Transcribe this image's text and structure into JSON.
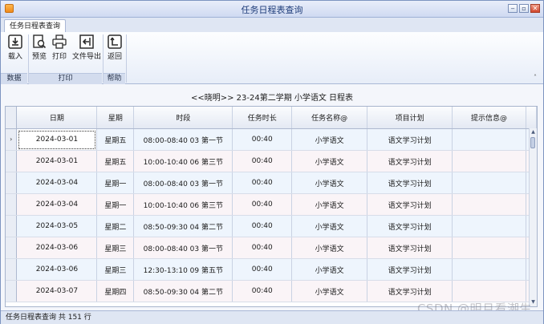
{
  "window": {
    "title": "任务日程表查询"
  },
  "ribbon": {
    "tab": "任务日程表查询",
    "buttons": {
      "import": "载入",
      "preview": "预览",
      "print": "打印",
      "export": "文件导出",
      "back": "返回"
    },
    "groups": {
      "data": "数据",
      "print": "打印",
      "help": "帮助"
    }
  },
  "heading": "<<晓明>>  23-24第二学期  小学语文  日程表",
  "columns": [
    "日期",
    "星期",
    "时段",
    "任务时长",
    "任务名称@",
    "项目计划",
    "提示信息@"
  ],
  "rows": [
    {
      "date": "2024-03-01",
      "weekday": "星期五",
      "period": "08:00-08:40 03 第一节",
      "duration": "00:40",
      "task": "小学语文",
      "plan": "语文学习计划",
      "tip": ""
    },
    {
      "date": "2024-03-01",
      "weekday": "星期五",
      "period": "10:00-10:40 06 第三节",
      "duration": "00:40",
      "task": "小学语文",
      "plan": "语文学习计划",
      "tip": ""
    },
    {
      "date": "2024-03-04",
      "weekday": "星期一",
      "period": "08:00-08:40 03 第一节",
      "duration": "00:40",
      "task": "小学语文",
      "plan": "语文学习计划",
      "tip": ""
    },
    {
      "date": "2024-03-04",
      "weekday": "星期一",
      "period": "10:00-10:40 06 第三节",
      "duration": "00:40",
      "task": "小学语文",
      "plan": "语文学习计划",
      "tip": ""
    },
    {
      "date": "2024-03-05",
      "weekday": "星期二",
      "period": "08:50-09:30 04 第二节",
      "duration": "00:40",
      "task": "小学语文",
      "plan": "语文学习计划",
      "tip": ""
    },
    {
      "date": "2024-03-06",
      "weekday": "星期三",
      "period": "08:00-08:40 03 第一节",
      "duration": "00:40",
      "task": "小学语文",
      "plan": "语文学习计划",
      "tip": ""
    },
    {
      "date": "2024-03-06",
      "weekday": "星期三",
      "period": "12:30-13:10 09 第五节",
      "duration": "00:40",
      "task": "小学语文",
      "plan": "语文学习计划",
      "tip": ""
    },
    {
      "date": "2024-03-07",
      "weekday": "星期四",
      "period": "08:50-09:30 04 第二节",
      "duration": "00:40",
      "task": "小学语文",
      "plan": "语文学习计划",
      "tip": ""
    }
  ],
  "status": "任务日程表查询 共 151 行",
  "watermark": "CSDN @明月看潮生"
}
